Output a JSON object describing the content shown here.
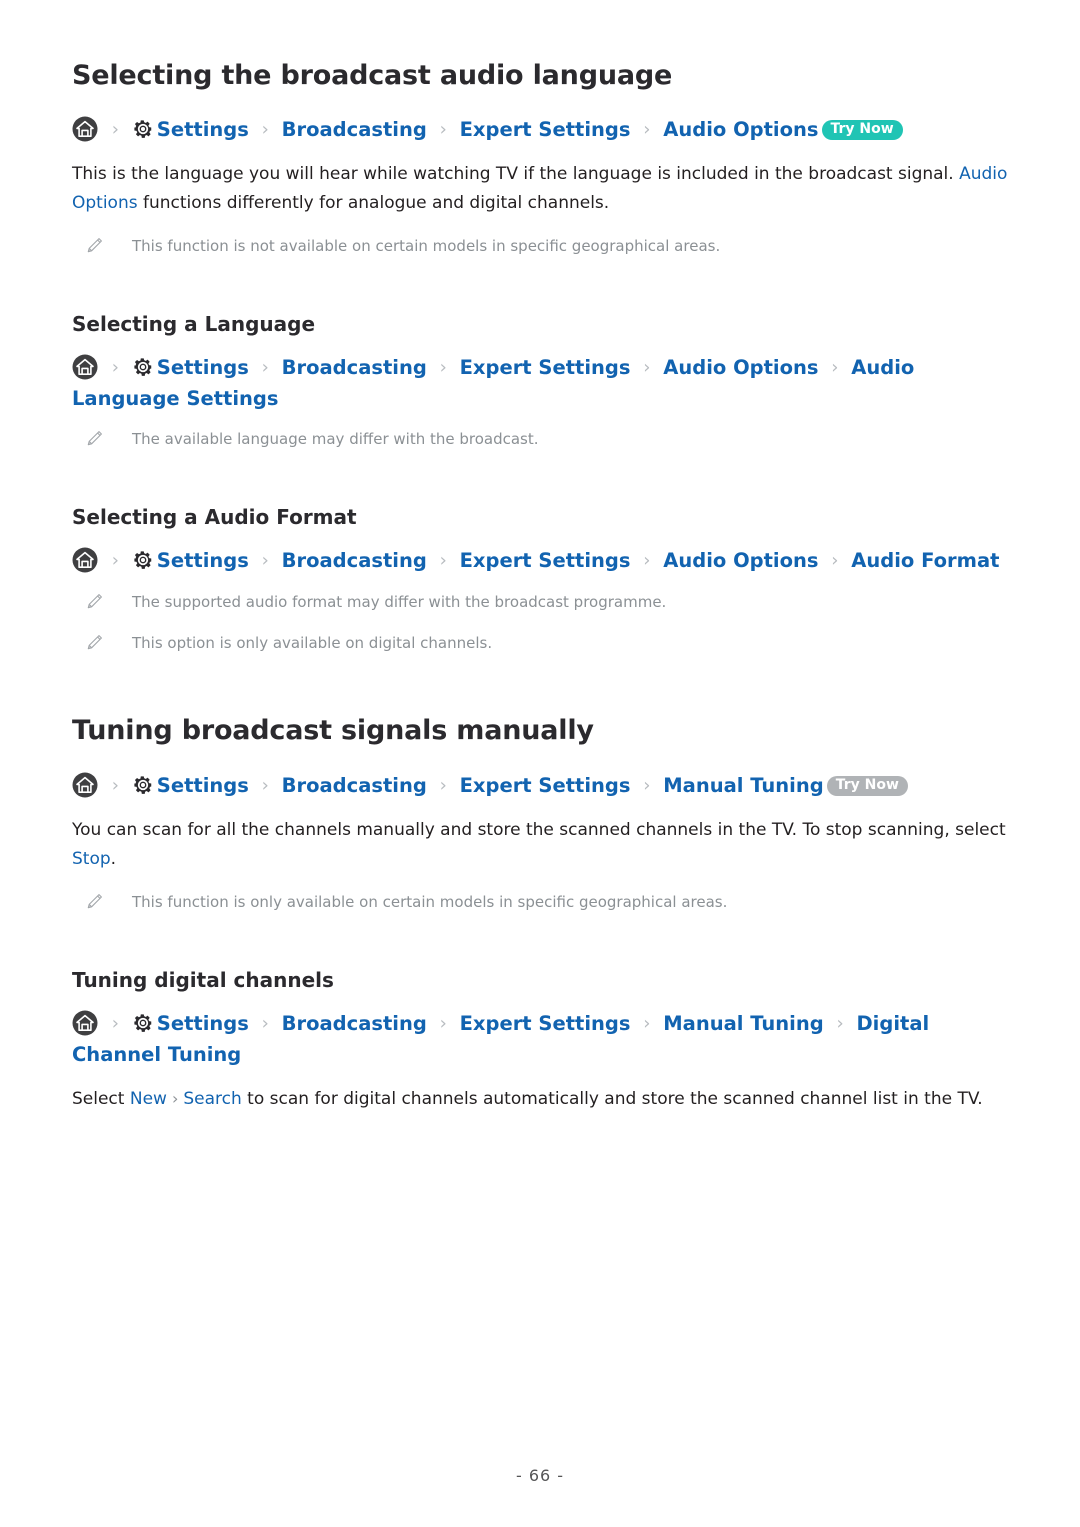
{
  "document": {
    "page_number": "- 66 -",
    "accent_link_color": "#1263b0",
    "badge_active_color": "#20c4b4",
    "badge_disabled_color": "#b0b3b6",
    "note_text_color": "#8b9094"
  },
  "sections": [
    {
      "id": "broadcast-audio-language",
      "title": "Selecting the broadcast audio language",
      "breadcrumb": {
        "home_icon": "home-icon",
        "gear_icon": "gear-icon",
        "items": [
          "Settings",
          "Broadcasting",
          "Expert Settings",
          "Audio Options"
        ],
        "badge": {
          "label": "Try Now",
          "state": "active"
        }
      },
      "paragraph": {
        "part1": "This is the language you will hear while watching TV if the language is included in the broadcast signal. ",
        "link1": "Audio Options",
        "part2": " functions differently for analogue and digital channels."
      },
      "notes": [
        "This function is not available on certain models in specific geographical areas."
      ]
    },
    {
      "id": "selecting-a-language",
      "title": "Selecting a Language",
      "breadcrumb": {
        "home_icon": "home-icon",
        "gear_icon": "gear-icon",
        "items": [
          "Settings",
          "Broadcasting",
          "Expert Settings",
          "Audio Options",
          "Audio Language Settings"
        ],
        "badge": null
      },
      "notes": [
        "The available language may differ with the broadcast."
      ]
    },
    {
      "id": "selecting-an-audio-format",
      "title": "Selecting a Audio Format",
      "breadcrumb": {
        "home_icon": "home-icon",
        "gear_icon": "gear-icon",
        "items": [
          "Settings",
          "Broadcasting",
          "Expert Settings",
          "Audio Options",
          "Audio Format"
        ],
        "badge": null
      },
      "notes": [
        "The supported audio format may differ with the broadcast programme.",
        "This option is only available on digital channels."
      ]
    },
    {
      "id": "tuning-broadcast-signals-manually",
      "title": "Tuning broadcast signals manually",
      "breadcrumb": {
        "home_icon": "home-icon",
        "gear_icon": "gear-icon",
        "items": [
          "Settings",
          "Broadcasting",
          "Expert Settings",
          "Manual Tuning"
        ],
        "badge": {
          "label": "Try Now",
          "state": "disabled"
        }
      },
      "paragraph": {
        "part1": "You can scan for all the channels manually and store the scanned channels in the TV. To stop scanning, select ",
        "link1": "Stop",
        "part2": "."
      },
      "notes": [
        "This function is only available on certain models in specific geographical areas."
      ]
    },
    {
      "id": "tuning-digital-channels",
      "title": "Tuning digital channels",
      "breadcrumb": {
        "home_icon": "home-icon",
        "gear_icon": "gear-icon",
        "items": [
          "Settings",
          "Broadcasting",
          "Expert Settings",
          "Manual Tuning",
          "Digital Channel Tuning"
        ],
        "badge": null
      },
      "paragraph": {
        "part1": "Select ",
        "link1": "New",
        "sep": "›",
        "link2": "Search",
        "part2": " to scan for digital channels automatically and store the scanned channel list in the TV."
      },
      "notes": []
    }
  ]
}
